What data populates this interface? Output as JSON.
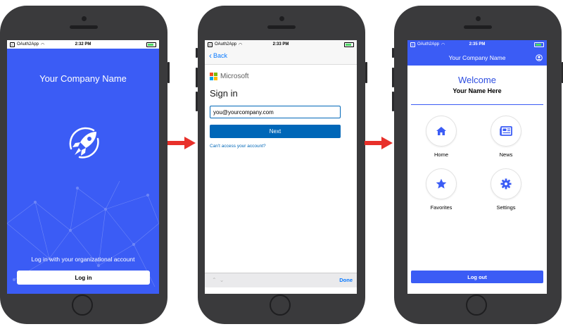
{
  "colors": {
    "brand_blue": "#3b5cf5",
    "ms_blue": "#0067b8",
    "arrow_red": "#e8302a",
    "ios_blue": "#0a7aff"
  },
  "status_bars": [
    {
      "carrier": "OAuth2App",
      "time": "2:32 PM"
    },
    {
      "carrier": "OAuth2App",
      "time": "2:33 PM"
    },
    {
      "carrier": "OAuth2App",
      "time": "2:35 PM"
    }
  ],
  "screen1": {
    "company_name": "Your Company Name",
    "hint": "Log in with your organizational account",
    "login_label": "Log in",
    "icon": "rocket-icon"
  },
  "screen2": {
    "back_label": "Back",
    "brand": "Microsoft",
    "heading": "Sign in",
    "email_value": "you@yourcompany.com",
    "next_label": "Next",
    "cant_access": "Can't access your account?",
    "done_label": "Done"
  },
  "screen3": {
    "title": "Your Company Name",
    "welcome": "Welcome",
    "user_name": "Your Name Here",
    "tiles": [
      {
        "label": "Home",
        "icon": "home-icon"
      },
      {
        "label": "News",
        "icon": "newspaper-icon"
      },
      {
        "label": "Favorites",
        "icon": "star-icon"
      },
      {
        "label": "Settings",
        "icon": "gear-icon"
      }
    ],
    "logout_label": "Log out"
  }
}
